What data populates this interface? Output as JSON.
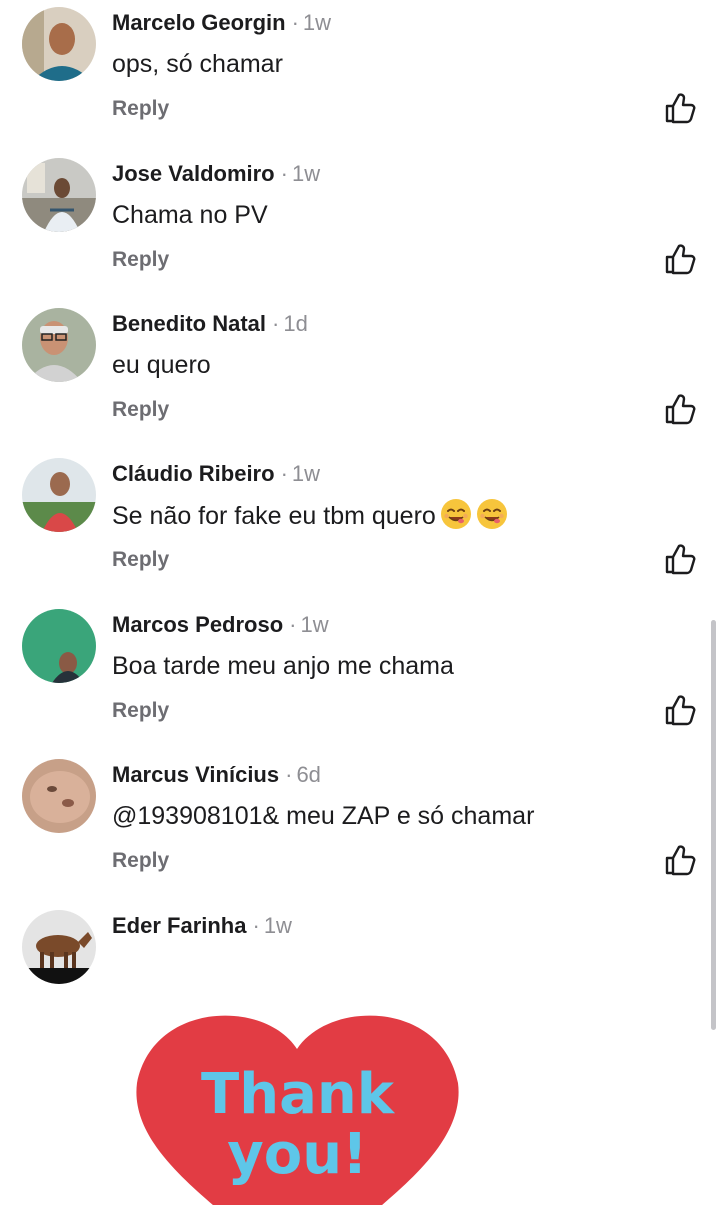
{
  "comments": [
    {
      "name": "Marcelo Georgin",
      "time": "1w",
      "text": "ops, só chamar",
      "reply": "Reply"
    },
    {
      "name": "Jose Valdomiro",
      "time": "1w",
      "text": "Chama no PV",
      "reply": "Reply"
    },
    {
      "name": "Benedito Natal",
      "time": "1d",
      "text": "eu quero",
      "reply": "Reply"
    },
    {
      "name": "Cláudio Ribeiro",
      "time": "1w",
      "text": "Se não for fake eu tbm quero",
      "reply": "Reply"
    },
    {
      "name": "Marcos Pedroso",
      "time": "1w",
      "text": "Boa tarde meu anjo me chama",
      "reply": "Reply"
    },
    {
      "name": "Marcus Vinícius",
      "time": "6d",
      "text": "@193908101& meu ZAP e só chamar",
      "reply": "Reply"
    },
    {
      "name": "Eder Farinha",
      "time": "1w"
    }
  ],
  "sticker": {
    "line1": "Thank",
    "line2": "you!",
    "heart_color": "#e23c44",
    "text_color": "#5ec6e8"
  },
  "icons": {
    "like": "thumbs-up-icon",
    "emoji": "smiling-face-emoji"
  },
  "colors": {
    "name": "#1c1c1e",
    "meta": "#8e8e93",
    "reply": "#6d6d72"
  }
}
